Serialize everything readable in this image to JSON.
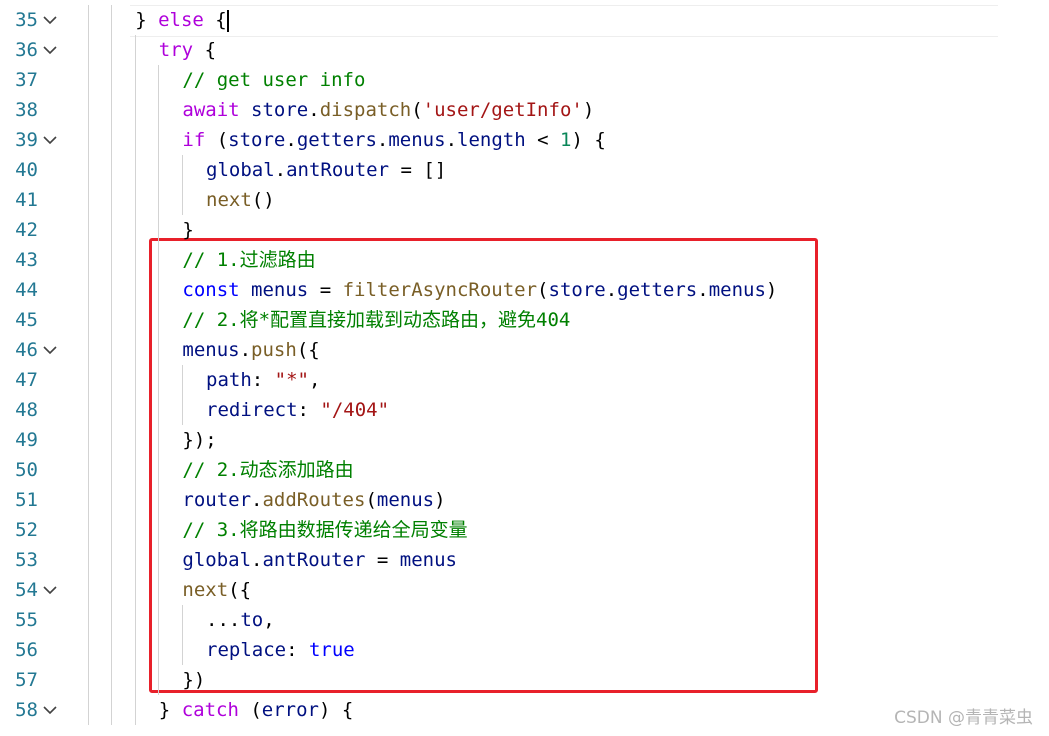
{
  "editor": {
    "lines": [
      {
        "n": "35",
        "fold": true,
        "indent": 2,
        "tokens": [
          [
            "pun",
            "} "
          ],
          [
            "ctl",
            "else"
          ],
          [
            "pun",
            " {"
          ]
        ]
      },
      {
        "n": "36",
        "fold": true,
        "indent": 3,
        "tokens": [
          [
            "ctl",
            "try"
          ],
          [
            "pun",
            " {"
          ]
        ]
      },
      {
        "n": "37",
        "fold": false,
        "indent": 4,
        "tokens": [
          [
            "cmt",
            "// get user info"
          ]
        ]
      },
      {
        "n": "38",
        "fold": false,
        "indent": 4,
        "tokens": [
          [
            "ctl",
            "await"
          ],
          [
            "pun",
            " "
          ],
          [
            "var",
            "store"
          ],
          [
            "pun",
            "."
          ],
          [
            "fn",
            "dispatch"
          ],
          [
            "pun",
            "("
          ],
          [
            "str",
            "'user/getInfo'"
          ],
          [
            "pun",
            ")"
          ]
        ]
      },
      {
        "n": "39",
        "fold": true,
        "indent": 4,
        "tokens": [
          [
            "ctl",
            "if"
          ],
          [
            "pun",
            " ("
          ],
          [
            "var",
            "store"
          ],
          [
            "pun",
            "."
          ],
          [
            "var",
            "getters"
          ],
          [
            "pun",
            "."
          ],
          [
            "var",
            "menus"
          ],
          [
            "pun",
            "."
          ],
          [
            "var",
            "length"
          ],
          [
            "pun",
            " < "
          ],
          [
            "num",
            "1"
          ],
          [
            "pun",
            ") {"
          ]
        ]
      },
      {
        "n": "40",
        "fold": false,
        "indent": 5,
        "tokens": [
          [
            "var",
            "global"
          ],
          [
            "pun",
            "."
          ],
          [
            "var",
            "antRouter"
          ],
          [
            "pun",
            " = []"
          ]
        ]
      },
      {
        "n": "41",
        "fold": false,
        "indent": 5,
        "tokens": [
          [
            "fn",
            "next"
          ],
          [
            "pun",
            "()"
          ]
        ]
      },
      {
        "n": "42",
        "fold": false,
        "indent": 4,
        "tokens": [
          [
            "pun",
            "}"
          ]
        ]
      },
      {
        "n": "43",
        "fold": false,
        "indent": 4,
        "tokens": [
          [
            "cmt",
            "// 1.过滤路由"
          ]
        ]
      },
      {
        "n": "44",
        "fold": false,
        "indent": 4,
        "tokens": [
          [
            "kw",
            "const"
          ],
          [
            "pun",
            " "
          ],
          [
            "var",
            "menus"
          ],
          [
            "pun",
            " = "
          ],
          [
            "fn",
            "filterAsyncRouter"
          ],
          [
            "pun",
            "("
          ],
          [
            "var",
            "store"
          ],
          [
            "pun",
            "."
          ],
          [
            "var",
            "getters"
          ],
          [
            "pun",
            "."
          ],
          [
            "var",
            "menus"
          ],
          [
            "pun",
            ")"
          ]
        ]
      },
      {
        "n": "45",
        "fold": false,
        "indent": 4,
        "tokens": [
          [
            "cmt",
            "// 2.将*配置直接加载到动态路由，避免404"
          ]
        ]
      },
      {
        "n": "46",
        "fold": true,
        "indent": 4,
        "tokens": [
          [
            "var",
            "menus"
          ],
          [
            "pun",
            "."
          ],
          [
            "fn",
            "push"
          ],
          [
            "pun",
            "({"
          ]
        ]
      },
      {
        "n": "47",
        "fold": false,
        "indent": 5,
        "tokens": [
          [
            "var",
            "path"
          ],
          [
            "pun",
            ": "
          ],
          [
            "str",
            "\"*\""
          ],
          [
            "pun",
            ","
          ]
        ]
      },
      {
        "n": "48",
        "fold": false,
        "indent": 5,
        "tokens": [
          [
            "var",
            "redirect"
          ],
          [
            "pun",
            ": "
          ],
          [
            "str",
            "\"/404\""
          ]
        ]
      },
      {
        "n": "49",
        "fold": false,
        "indent": 4,
        "tokens": [
          [
            "pun",
            "});"
          ]
        ]
      },
      {
        "n": "50",
        "fold": false,
        "indent": 4,
        "tokens": [
          [
            "cmt",
            "// 2.动态添加路由"
          ]
        ]
      },
      {
        "n": "51",
        "fold": false,
        "indent": 4,
        "tokens": [
          [
            "var",
            "router"
          ],
          [
            "pun",
            "."
          ],
          [
            "fn",
            "addRoutes"
          ],
          [
            "pun",
            "("
          ],
          [
            "var",
            "menus"
          ],
          [
            "pun",
            ")"
          ]
        ]
      },
      {
        "n": "52",
        "fold": false,
        "indent": 4,
        "tokens": [
          [
            "cmt",
            "// 3.将路由数据传递给全局变量"
          ]
        ]
      },
      {
        "n": "53",
        "fold": false,
        "indent": 4,
        "tokens": [
          [
            "var",
            "global"
          ],
          [
            "pun",
            "."
          ],
          [
            "var",
            "antRouter"
          ],
          [
            "pun",
            " = "
          ],
          [
            "var",
            "menus"
          ]
        ]
      },
      {
        "n": "54",
        "fold": true,
        "indent": 4,
        "tokens": [
          [
            "fn",
            "next"
          ],
          [
            "pun",
            "({"
          ]
        ]
      },
      {
        "n": "55",
        "fold": false,
        "indent": 5,
        "tokens": [
          [
            "pun",
            "..."
          ],
          [
            "var",
            "to"
          ],
          [
            "pun",
            ","
          ]
        ]
      },
      {
        "n": "56",
        "fold": false,
        "indent": 5,
        "tokens": [
          [
            "var",
            "replace"
          ],
          [
            "pun",
            ": "
          ],
          [
            "kw",
            "true"
          ]
        ]
      },
      {
        "n": "57",
        "fold": false,
        "indent": 4,
        "tokens": [
          [
            "pun",
            "})"
          ]
        ]
      },
      {
        "n": "58",
        "fold": true,
        "indent": 3,
        "tokens": [
          [
            "pun",
            "} "
          ],
          [
            "ctl",
            "catch"
          ],
          [
            "pun",
            " ("
          ],
          [
            "var",
            "error"
          ],
          [
            "pun",
            ") {"
          ]
        ]
      }
    ]
  },
  "watermark": "CSDN @青青菜虫",
  "colors": {
    "line_number": "#237893",
    "highlight_border": "#e8202a",
    "comment": "#008000",
    "control_keyword": "#af00db",
    "keyword": "#0000ff",
    "function": "#795e26",
    "variable": "#001080",
    "string": "#a31515",
    "number": "#098658"
  },
  "icons": {
    "fold": "chevron-down-icon"
  }
}
